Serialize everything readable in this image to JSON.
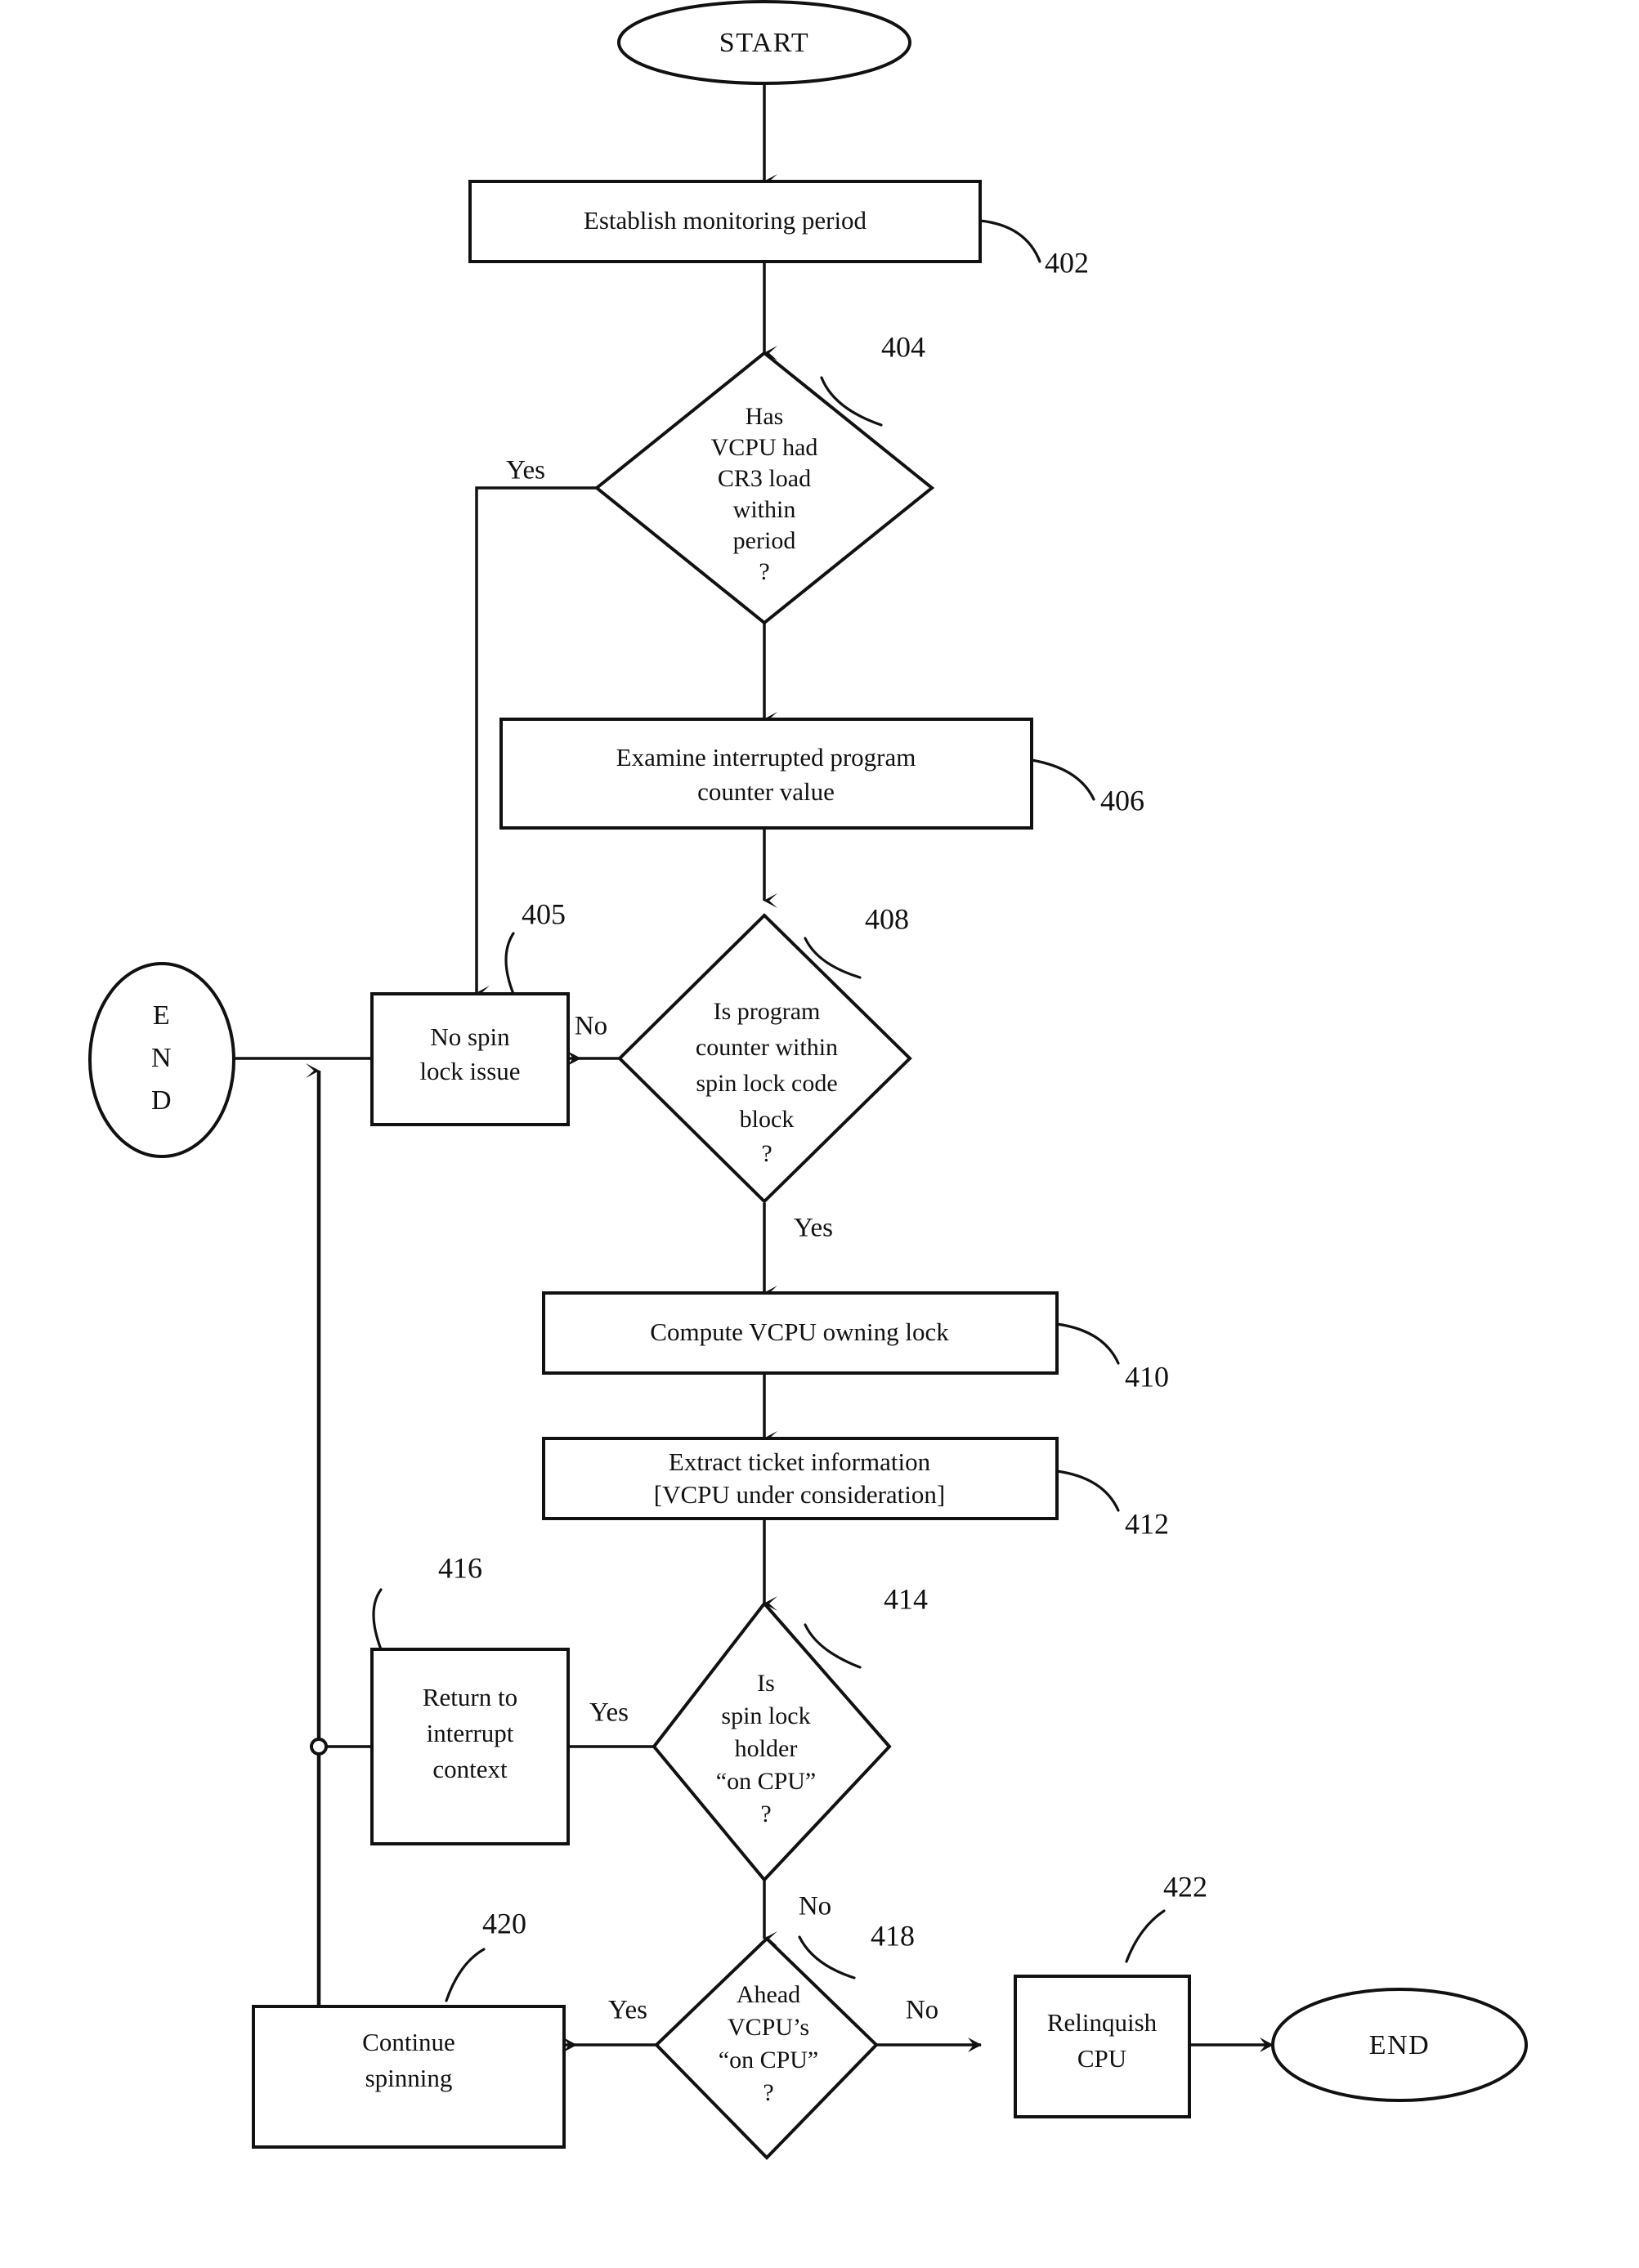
{
  "diagram": {
    "kind": "patent-flowchart",
    "terminals": {
      "start": "START",
      "end_left_lines": [
        "E",
        "N",
        "D"
      ],
      "end_right": "END"
    },
    "nodes": [
      {
        "id": "n402",
        "ref": "402",
        "shape": "process",
        "lines": [
          "Establish monitoring period"
        ]
      },
      {
        "id": "n404",
        "ref": "404",
        "shape": "decision",
        "lines": [
          "Has",
          "VCPU had",
          "CR3 load",
          "within",
          "period",
          "?"
        ]
      },
      {
        "id": "n406",
        "ref": "406",
        "shape": "process",
        "lines": [
          "Examine interrupted program",
          "counter value"
        ]
      },
      {
        "id": "n405",
        "ref": "405",
        "shape": "process",
        "lines": [
          "No spin",
          "lock issue"
        ]
      },
      {
        "id": "n408",
        "ref": "408",
        "shape": "decision",
        "lines": [
          "Is program",
          "counter within",
          "spin lock code",
          "block",
          "?"
        ]
      },
      {
        "id": "n410",
        "ref": "410",
        "shape": "process",
        "lines": [
          "Compute VCPU owning lock"
        ]
      },
      {
        "id": "n412",
        "ref": "412",
        "shape": "process",
        "lines": [
          "Extract ticket information",
          "[VCPU under consideration]"
        ]
      },
      {
        "id": "n414",
        "ref": "414",
        "shape": "decision",
        "lines": [
          "Is",
          "spin lock",
          "holder",
          "“on CPU”",
          "?"
        ]
      },
      {
        "id": "n416",
        "ref": "416",
        "shape": "process",
        "lines": [
          "Return to",
          "interrupt",
          "context"
        ]
      },
      {
        "id": "n418",
        "ref": "418",
        "shape": "decision",
        "lines": [
          "Ahead",
          "VCPU’s",
          "“on CPU”",
          "?"
        ]
      },
      {
        "id": "n420",
        "ref": "420",
        "shape": "process",
        "lines": [
          "Continue",
          "spinning"
        ]
      },
      {
        "id": "n422",
        "ref": "422",
        "shape": "process",
        "lines": [
          "Relinquish",
          "CPU"
        ]
      }
    ],
    "branch_labels": {
      "b404_yes": "Yes",
      "b408_no": "No",
      "b408_yes": "Yes",
      "b414_yes": "Yes",
      "b414_no": "No",
      "b418_yes": "Yes",
      "b418_no": "No"
    },
    "colors": {
      "ink": "#111111",
      "paper": "#ffffff"
    }
  }
}
